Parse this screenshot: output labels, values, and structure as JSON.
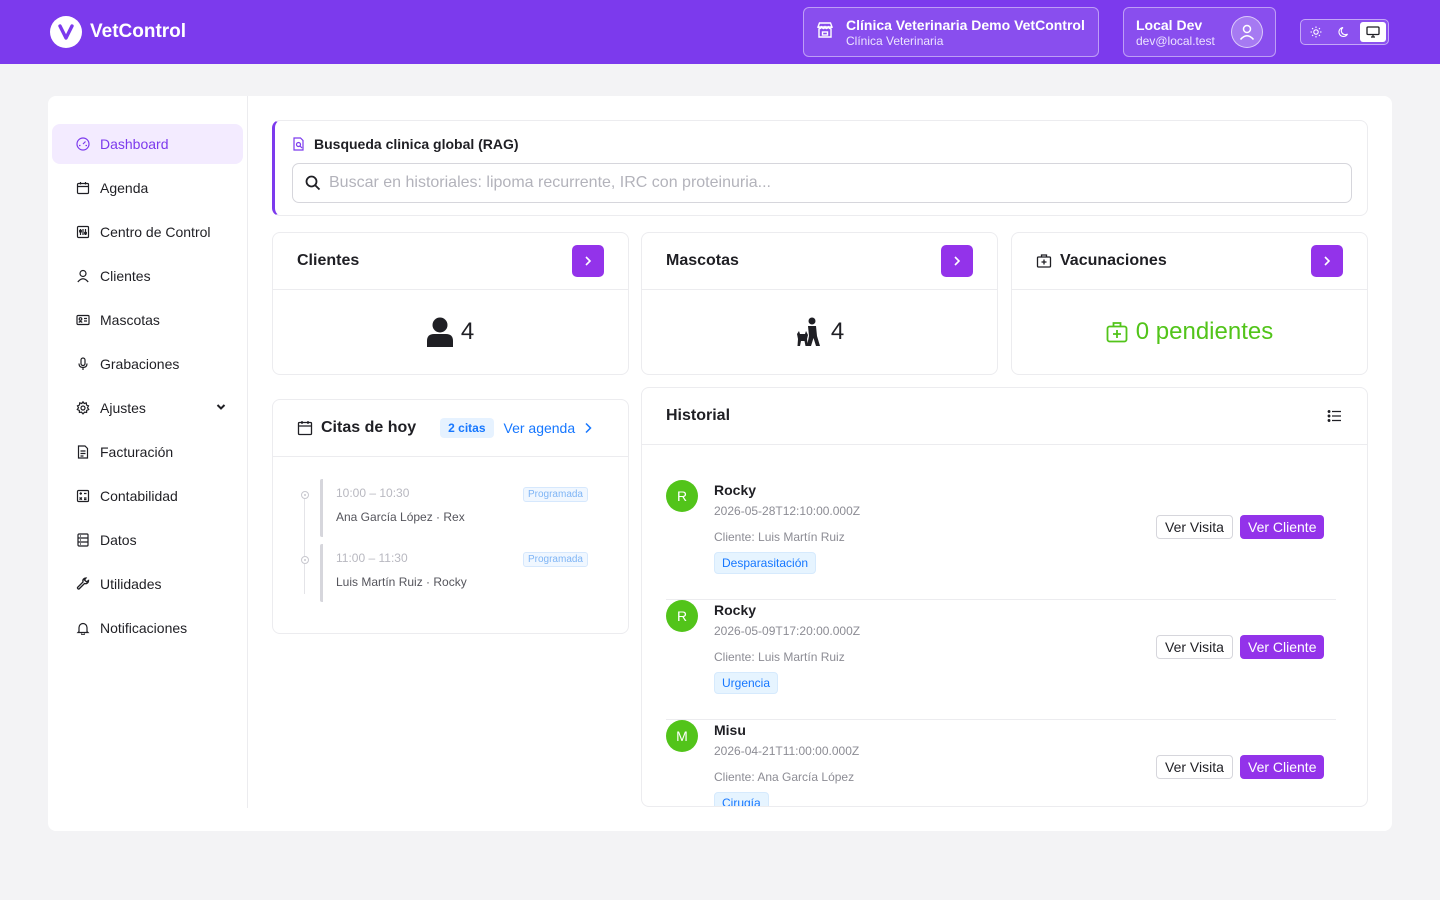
{
  "header": {
    "app_name": "VetControl",
    "logo_letter": "V",
    "clinic_name": "Clínica Veterinaria Demo VetControl",
    "clinic_type": "Clínica Veterinaria",
    "user_name": "Local Dev",
    "user_email": "dev@local.test",
    "theme_modes": [
      "sun-icon",
      "moon-icon",
      "monitor-icon"
    ],
    "active_theme": "monitor-icon",
    "brand_color": "#7c3aed"
  },
  "sidebar": {
    "items": [
      {
        "label": "Dashboard",
        "icon": "dashboard-icon",
        "active": true
      },
      {
        "label": "Agenda",
        "icon": "calendar-icon"
      },
      {
        "label": "Centro de Control",
        "icon": "control-center-icon"
      },
      {
        "label": "Clientes",
        "icon": "user-icon"
      },
      {
        "label": "Mascotas",
        "icon": "pet-card-icon"
      },
      {
        "label": "Grabaciones",
        "icon": "microphone-icon"
      },
      {
        "label": "Ajustes",
        "icon": "gear-icon",
        "expandable": true
      },
      {
        "label": "Facturación",
        "icon": "invoice-icon"
      },
      {
        "label": "Contabilidad",
        "icon": "accounting-icon"
      },
      {
        "label": "Datos",
        "icon": "database-icon"
      },
      {
        "label": "Utilidades",
        "icon": "wrench-icon"
      },
      {
        "label": "Notificaciones",
        "icon": "bell-icon"
      }
    ]
  },
  "search": {
    "title": "Busqueda clinica global (RAG)",
    "placeholder": "Buscar en historiales: lipoma recurrente, IRC con proteinuria...",
    "value": ""
  },
  "stats": {
    "clientes": {
      "title": "Clientes",
      "value": "4"
    },
    "mascotas": {
      "title": "Mascotas",
      "value": "4"
    },
    "vacunaciones": {
      "title": "Vacunaciones",
      "value": "0 pendientes",
      "color": "#52c41a"
    }
  },
  "citas": {
    "title": "Citas de hoy",
    "badge": "2 citas",
    "link": "Ver agenda",
    "items": [
      {
        "time": "10:00 – 10:30",
        "who": "Ana García López · Rex",
        "status": "Programada"
      },
      {
        "time": "11:00 – 11:30",
        "who": "Luis Martín Ruiz · Rocky",
        "status": "Programada"
      }
    ]
  },
  "historial": {
    "title": "Historial",
    "view_visit_label": "Ver Visita",
    "view_client_label": "Ver Cliente",
    "rows": [
      {
        "initial": "R",
        "name": "Rocky",
        "date": "2026-05-28T12:10:00.000Z",
        "client": "Cliente: Luis Martín Ruiz",
        "tag": "Desparasitación"
      },
      {
        "initial": "R",
        "name": "Rocky",
        "date": "2026-05-09T17:20:00.000Z",
        "client": "Cliente: Luis Martín Ruiz",
        "tag": "Urgencia"
      },
      {
        "initial": "M",
        "name": "Misu",
        "date": "2026-04-21T11:00:00.000Z",
        "client": "Cliente: Ana García López",
        "tag": "Cirugía"
      }
    ]
  }
}
